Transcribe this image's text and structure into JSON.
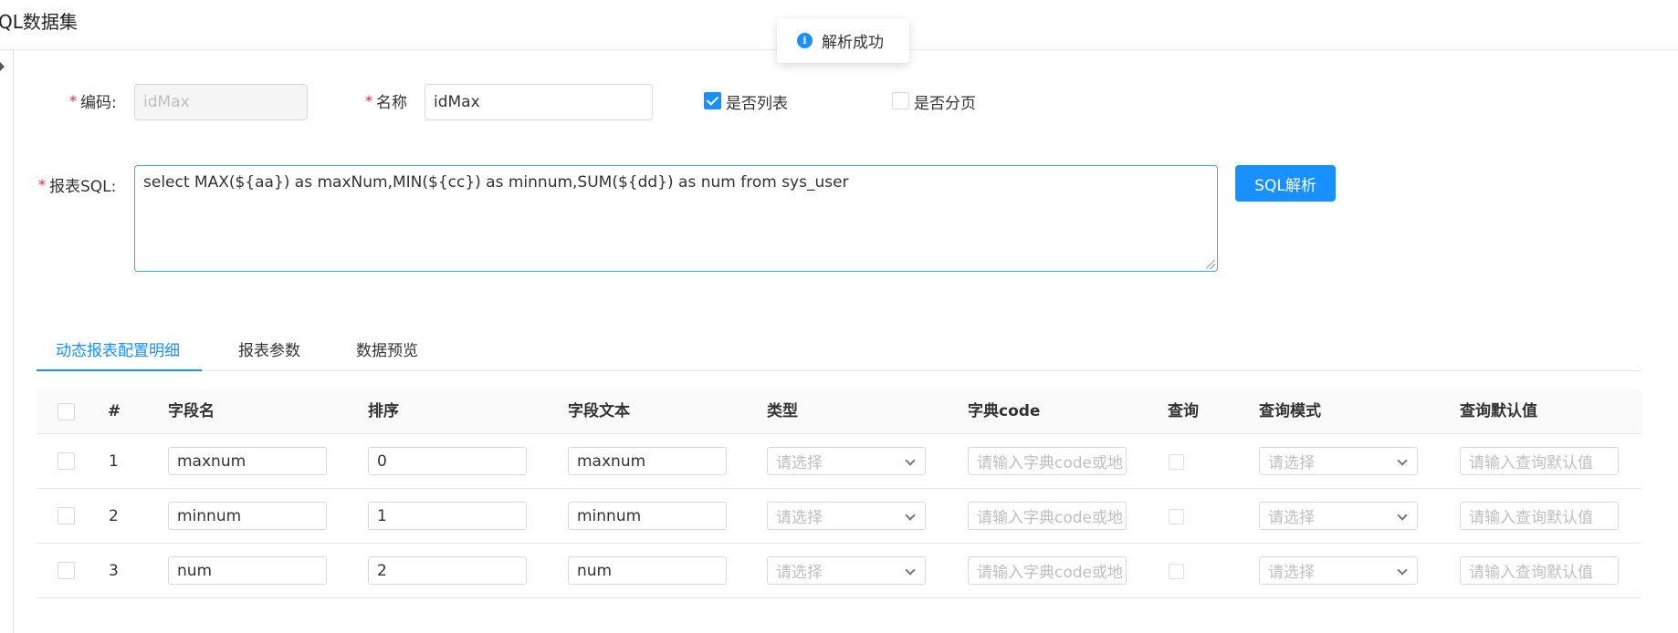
{
  "header": {
    "title": "QL数据集"
  },
  "toast": {
    "text": "解析成功"
  },
  "form": {
    "code": {
      "label": "编码:",
      "value": "idMax"
    },
    "name": {
      "label": "名称",
      "value": "idMax"
    },
    "is_list": {
      "label": "是否列表",
      "checked": true
    },
    "is_paged": {
      "label": "是否分页",
      "checked": false
    },
    "sql": {
      "label": "报表SQL:",
      "value": "select MAX(${aa}) as maxNum,MIN(${cc}) as minnum,SUM(${dd}) as num  from sys_user"
    },
    "parse_button": "SQL解析"
  },
  "tabs": [
    {
      "label": "动态报表配置明细",
      "active": true
    },
    {
      "label": "报表参数",
      "active": false
    },
    {
      "label": "数据预览",
      "active": false
    }
  ],
  "table": {
    "headers": [
      "#",
      "字段名",
      "排序",
      "字段文本",
      "类型",
      "字典code",
      "查询",
      "查询模式",
      "查询默认值"
    ],
    "rows": [
      {
        "index": "1",
        "field_name": "maxnum",
        "order": "0",
        "field_text": "maxnum"
      },
      {
        "index": "2",
        "field_name": "minnum",
        "order": "1",
        "field_text": "minnum"
      },
      {
        "index": "3",
        "field_name": "num",
        "order": "2",
        "field_text": "num"
      }
    ],
    "placeholders": {
      "type": "请选择",
      "dict_code": "请输入字典code或地",
      "query_mode": "请选择",
      "default_value": "请输入查询默认值"
    }
  },
  "colors": {
    "primary": "#1890ff",
    "required": "#f5222d"
  }
}
